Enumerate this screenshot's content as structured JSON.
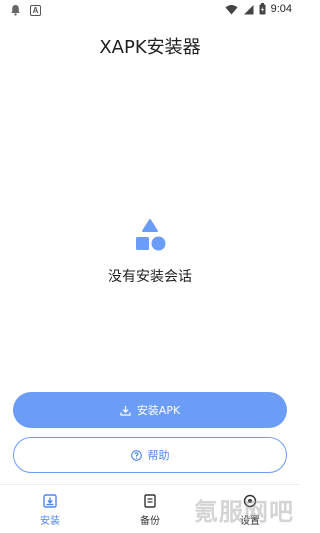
{
  "status_bar": {
    "time": "9:04",
    "badge": "A"
  },
  "app": {
    "title": "XAPK安装器"
  },
  "empty": {
    "message": "没有安装会话"
  },
  "buttons": {
    "install_label": "安装APK",
    "help_label": "帮助"
  },
  "nav": {
    "items": [
      {
        "label": "安装",
        "icon": "install-icon",
        "active": true
      },
      {
        "label": "备份",
        "icon": "backup-icon",
        "active": false
      },
      {
        "label": "设置",
        "icon": "settings-icon",
        "active": false
      }
    ]
  },
  "watermark": "氪服网吧",
  "colors": {
    "accent": "#6b9cf6",
    "accent_text": "#4d85ef"
  }
}
